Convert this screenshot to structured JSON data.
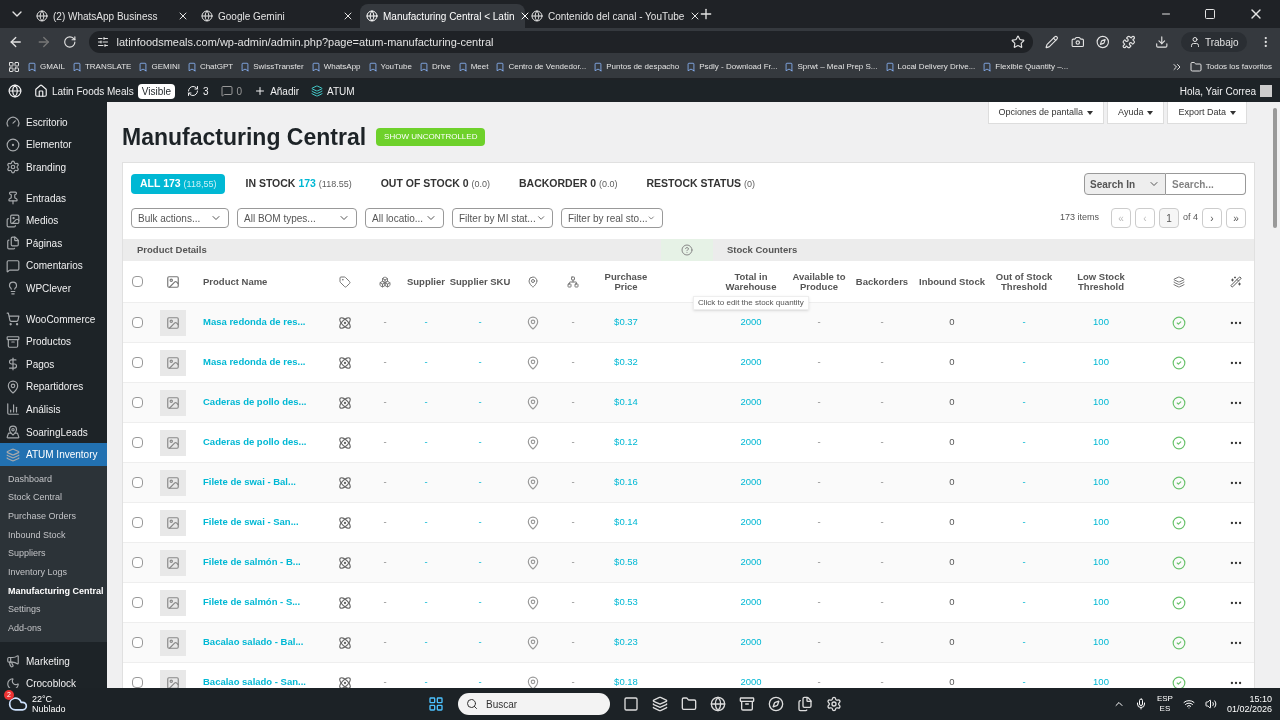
{
  "browser": {
    "tabs": [
      {
        "title": "(2) WhatsApp Business",
        "selected": false
      },
      {
        "title": "Google Gemini",
        "selected": false
      },
      {
        "title": "Manufacturing Central < Latin",
        "selected": true
      },
      {
        "title": "Contenido del canal - YouTube",
        "selected": false
      }
    ],
    "url": "latinfoodsmeals.com/wp-admin/admin.php?page=atum-manufacturing-central",
    "profile": "Trabajo",
    "bookmarks": [
      "GMAIL",
      "TRANSLATE",
      "GEMINI",
      "ChatGPT",
      "SwissTransfer",
      "WhatsApp",
      "YouTube",
      "Drive",
      "Meet",
      "Centro de Vendedor...",
      "Puntos de despacho",
      "Psdly - Download Fr...",
      "Sprwt – Meal Prep S...",
      "Local Delivery Drive...",
      "Flexible Quantity –..."
    ],
    "all_bookmarks": "Todos los favoritos"
  },
  "admin_bar": {
    "site": "Latin Foods Meals",
    "visibility": "Visible",
    "updates": "3",
    "comments": "0",
    "add": "Añadir",
    "plugin": "ATUM",
    "greeting": "Hola, Yair Correa"
  },
  "sidebar": {
    "sections": [
      {
        "items": [
          {
            "label": "Escritorio",
            "selected": false
          },
          {
            "label": "Elementor",
            "selected": false
          },
          {
            "label": "Branding",
            "selected": false
          }
        ]
      },
      {
        "items": [
          {
            "label": "Entradas",
            "selected": false
          },
          {
            "label": "Medios",
            "selected": false
          },
          {
            "label": "Páginas",
            "selected": false
          },
          {
            "label": "Comentarios",
            "selected": false
          },
          {
            "label": "WPClever",
            "selected": false
          }
        ]
      },
      {
        "items": [
          {
            "label": "WooCommerce",
            "selected": false
          },
          {
            "label": "Productos",
            "selected": false
          },
          {
            "label": "Pagos",
            "selected": false
          },
          {
            "label": "Repartidores",
            "selected": false
          },
          {
            "label": "Análisis",
            "selected": false
          },
          {
            "label": "SoaringLeads",
            "selected": false
          },
          {
            "label": "ATUM Inventory",
            "selected": true,
            "children": [
              {
                "label": "Dashboard",
                "selected": false
              },
              {
                "label": "Stock Central",
                "selected": false
              },
              {
                "label": "Purchase Orders",
                "selected": false
              },
              {
                "label": "Inbound Stock",
                "selected": false
              },
              {
                "label": "Suppliers",
                "selected": false
              },
              {
                "label": "Inventory Logs",
                "selected": false
              },
              {
                "label": "Manufacturing Central",
                "selected": true
              },
              {
                "label": "Settings",
                "selected": false
              },
              {
                "label": "Add-ons",
                "selected": false
              }
            ]
          }
        ]
      },
      {
        "items": [
          {
            "label": "Marketing",
            "selected": false
          },
          {
            "label": "Crocoblock",
            "selected": false
          }
        ]
      }
    ]
  },
  "screen_buttons": [
    "Opciones de pantalla",
    "Ayuda",
    "Export Data"
  ],
  "page": {
    "title": "Manufacturing Central",
    "badge": "SHOW UNCONTROLLED"
  },
  "views": [
    {
      "label": "ALL",
      "count": "173",
      "extra": "(118,55)",
      "selected": true
    },
    {
      "label": "IN STOCK",
      "count": "173",
      "extra": "(118.55)",
      "selected": false
    },
    {
      "label": "OUT OF STOCK",
      "count": "0",
      "extra": "(0.0)",
      "selected": false
    },
    {
      "label": "BACKORDER",
      "count": "0",
      "extra": "(0.0)",
      "selected": false
    },
    {
      "label": "RESTOCK STATUS",
      "extra": "(0)",
      "selected": false
    }
  ],
  "search": {
    "scope": "Search In",
    "placeholder": "Search..."
  },
  "filters": [
    "Bulk actions...",
    "All BOM types...",
    "All locatio...",
    "Filter by MI stat...",
    "Filter by real sto..."
  ],
  "pagination": {
    "items": "173 items",
    "first": "«",
    "prev": "‹",
    "page": "1",
    "of": "of 4",
    "next": "›",
    "last": "»"
  },
  "table": {
    "groups": [
      "Product Details",
      "Stock Counters"
    ],
    "columns": [
      "Product Name",
      "Supplier",
      "Supplier SKU",
      "Purchase Price",
      "Total in Warehouse",
      "Available to Produce",
      "Backorders",
      "Inbound Stock",
      "Out of Stock Threshold",
      "Low Stock Threshold"
    ],
    "tooltip": "Click to edit the stock quantity",
    "select_all": false,
    "rows": [
      {
        "checked": false,
        "name": "Masa redonda de res...",
        "bom": "-",
        "supplier": "-",
        "sku": "-",
        "column_9": "-",
        "price": "$0.37",
        "total": "2000",
        "available": "-",
        "backorders": "-",
        "inbound": "0",
        "out_threshold": "-",
        "low_threshold": "100",
        "in_stock": true
      },
      {
        "checked": false,
        "name": "Masa redonda de res...",
        "bom": "-",
        "supplier": "-",
        "sku": "-",
        "column_9": "-",
        "price": "$0.32",
        "total": "2000",
        "available": "-",
        "backorders": "-",
        "inbound": "0",
        "out_threshold": "-",
        "low_threshold": "100",
        "in_stock": true
      },
      {
        "checked": false,
        "name": "Caderas de pollo des...",
        "bom": "-",
        "supplier": "-",
        "sku": "-",
        "column_9": "-",
        "price": "$0.14",
        "total": "2000",
        "available": "-",
        "backorders": "-",
        "inbound": "0",
        "out_threshold": "-",
        "low_threshold": "100",
        "in_stock": true
      },
      {
        "checked": false,
        "name": "Caderas de pollo des...",
        "bom": "-",
        "supplier": "-",
        "sku": "-",
        "column_9": "-",
        "price": "$0.12",
        "total": "2000",
        "available": "-",
        "backorders": "-",
        "inbound": "0",
        "out_threshold": "-",
        "low_threshold": "100",
        "in_stock": true
      },
      {
        "checked": false,
        "name": "Filete de swai - Bal...",
        "bom": "-",
        "supplier": "-",
        "sku": "-",
        "column_9": "-",
        "price": "$0.16",
        "total": "2000",
        "available": "-",
        "backorders": "-",
        "inbound": "0",
        "out_threshold": "-",
        "low_threshold": "100",
        "in_stock": true
      },
      {
        "checked": false,
        "name": "Filete de swai - San...",
        "bom": "-",
        "supplier": "-",
        "sku": "-",
        "column_9": "-",
        "price": "$0.14",
        "total": "2000",
        "available": "-",
        "backorders": "-",
        "inbound": "0",
        "out_threshold": "-",
        "low_threshold": "100",
        "in_stock": true
      },
      {
        "checked": false,
        "name": "Filete de salmón - B...",
        "bom": "-",
        "supplier": "-",
        "sku": "-",
        "column_9": "-",
        "price": "$0.58",
        "total": "2000",
        "available": "-",
        "backorders": "-",
        "inbound": "0",
        "out_threshold": "-",
        "low_threshold": "100",
        "in_stock": true
      },
      {
        "checked": false,
        "name": "Filete de salmón - S...",
        "bom": "-",
        "supplier": "-",
        "sku": "-",
        "column_9": "-",
        "price": "$0.53",
        "total": "2000",
        "available": "-",
        "backorders": "-",
        "inbound": "0",
        "out_threshold": "-",
        "low_threshold": "100",
        "in_stock": true
      },
      {
        "checked": false,
        "name": "Bacalao salado - Bal...",
        "bom": "-",
        "supplier": "-",
        "sku": "-",
        "column_9": "-",
        "price": "$0.23",
        "total": "2000",
        "available": "-",
        "backorders": "-",
        "inbound": "0",
        "out_threshold": "-",
        "low_threshold": "100",
        "in_stock": true
      },
      {
        "checked": false,
        "name": "Bacalao salado - San...",
        "bom": "-",
        "supplier": "-",
        "sku": "-",
        "column_9": "-",
        "price": "$0.18",
        "total": "2000",
        "available": "-",
        "backorders": "-",
        "inbound": "0",
        "out_threshold": "-",
        "low_threshold": "100",
        "in_stock": true
      }
    ]
  },
  "taskbar": {
    "weather_alerts": "2",
    "temperature": "22°C",
    "condition": "Nublado",
    "search": "Buscar",
    "language": "ESP",
    "layout": "ES",
    "time": "15:10",
    "date": "01/02/2026"
  }
}
